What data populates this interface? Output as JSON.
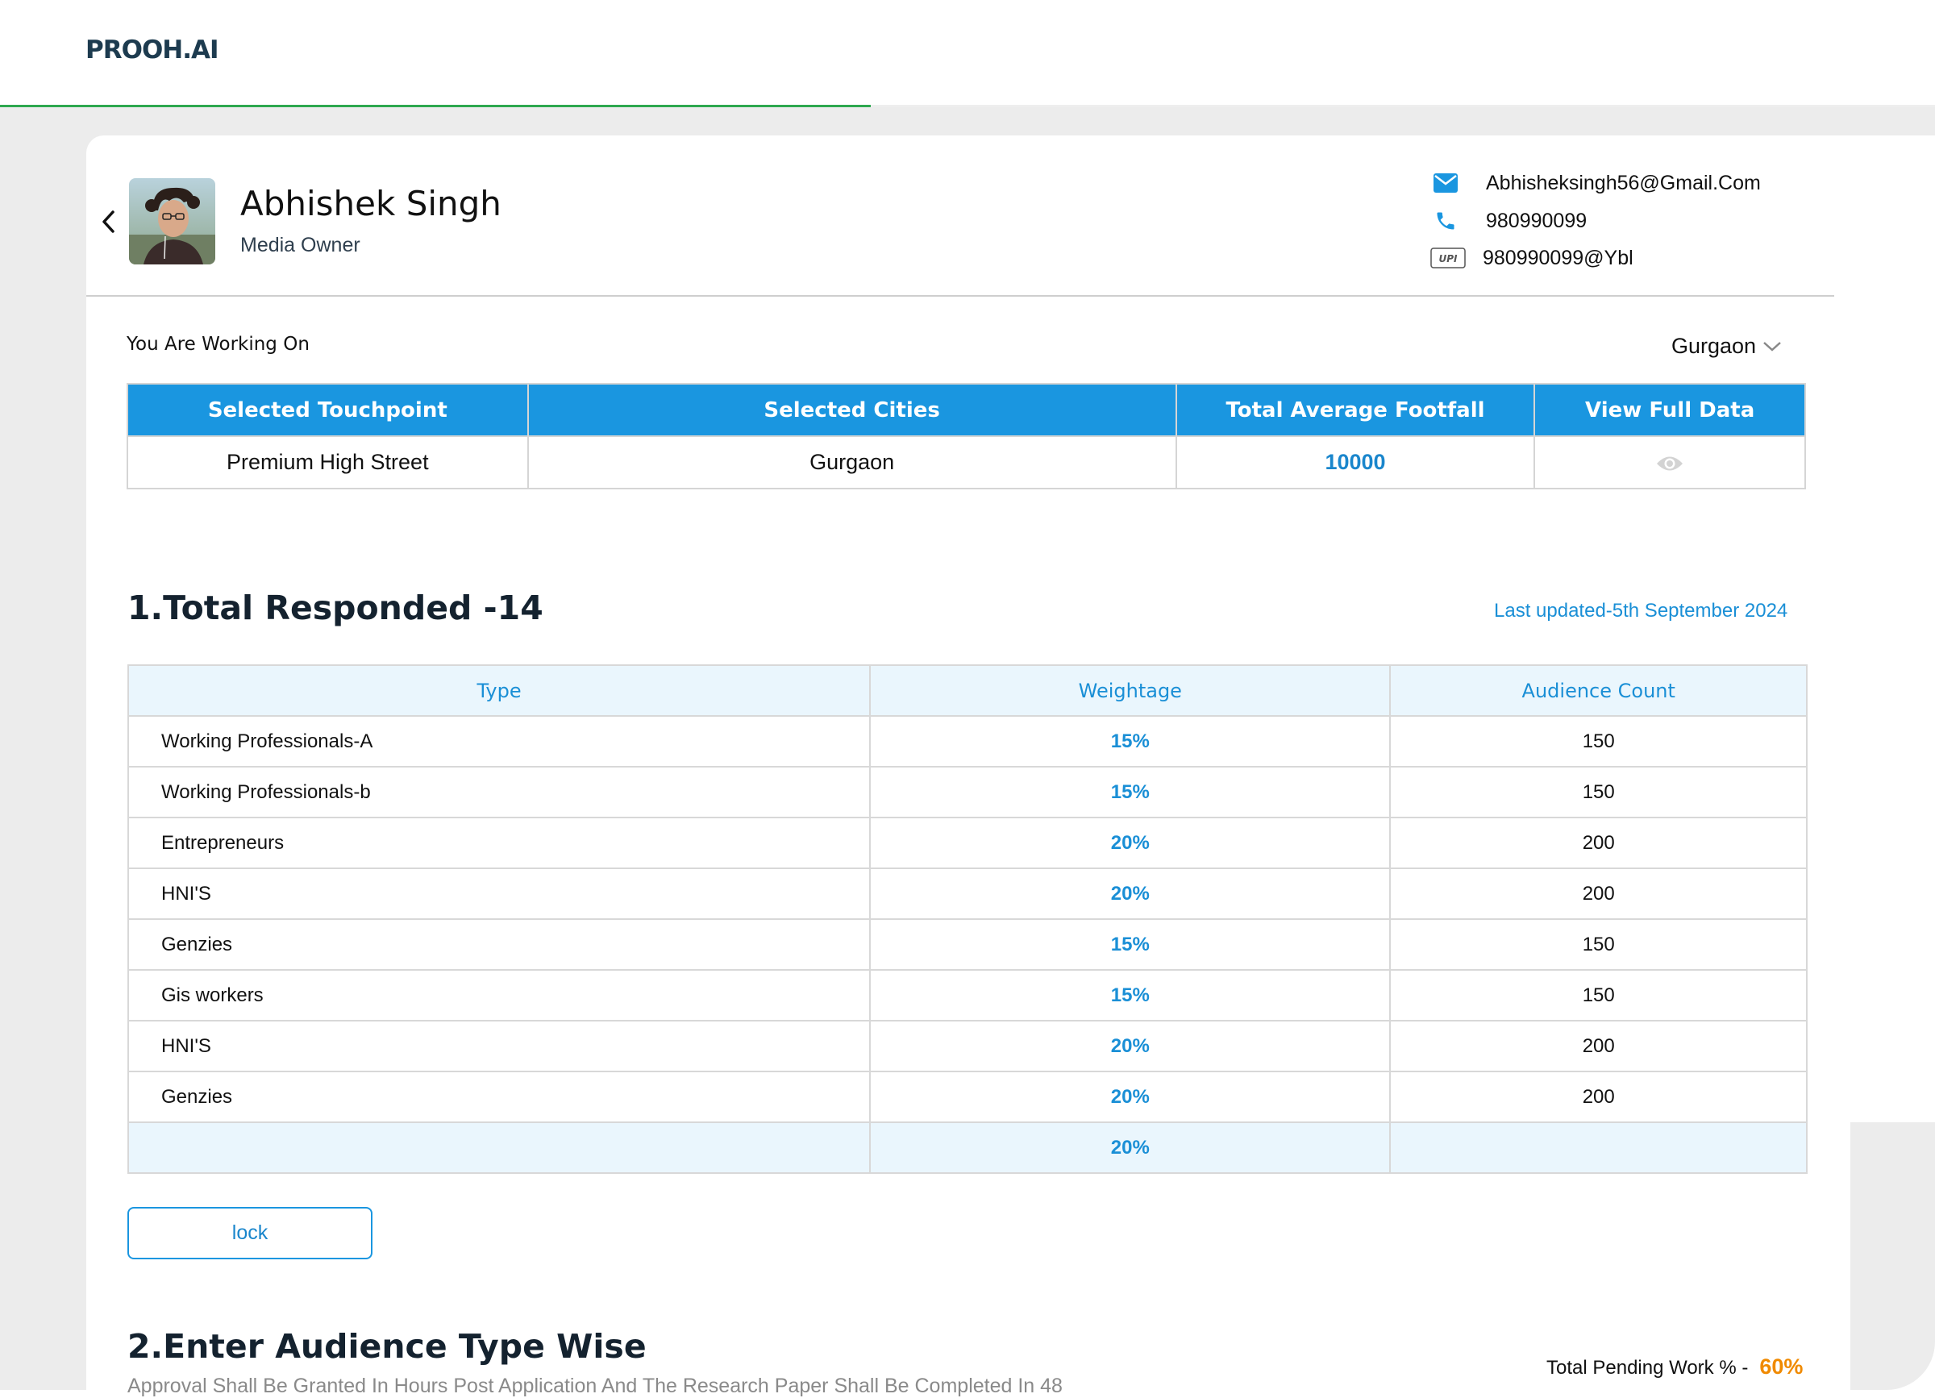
{
  "app": {
    "logo": "PROOH.AI",
    "progress_percent": 45
  },
  "profile": {
    "name": "Abhishek Singh",
    "role": "Media Owner",
    "email": "Abhisheksingh56@Gmail.Com",
    "phone": "980990099",
    "upi": "980990099@Ybl",
    "upi_badge": "UPI"
  },
  "working": {
    "label": "You Are Working On",
    "city": "Gurgaon"
  },
  "summary_table": {
    "headers": [
      "Selected Touchpoint",
      "Selected Cities",
      "Total Average Footfall",
      "View Full Data"
    ],
    "row": {
      "touchpoint": "Premium High Street",
      "cities": "Gurgaon",
      "footfall": "10000"
    }
  },
  "section1": {
    "title": "1.Total Responded -14",
    "updated": "Last updated-5th September 2024",
    "headers": [
      "Type",
      "Weightage",
      "Audience Count"
    ],
    "rows": [
      {
        "type": "Working Professionals-A",
        "weightage": "15%",
        "count": "150"
      },
      {
        "type": "Working Professionals-b",
        "weightage": "15%",
        "count": "150"
      },
      {
        "type": "Entrepreneurs",
        "weightage": "20%",
        "count": "200"
      },
      {
        "type": "HNI'S",
        "weightage": "20%",
        "count": "200"
      },
      {
        "type": "Genzies",
        "weightage": "15%",
        "count": "150"
      },
      {
        "type": "Gis workers",
        "weightage": "15%",
        "count": "150"
      },
      {
        "type": "HNI'S",
        "weightage": "20%",
        "count": "200"
      },
      {
        "type": "Genzies",
        "weightage": "20%",
        "count": "200"
      }
    ],
    "footer_weightage": "20%",
    "lock_label": "lock"
  },
  "section2": {
    "title": "2.Enter Audience Type Wise",
    "approval_text": "Approval Shall Be Granted In  Hours Post Application And The Research Paper Shall Be Completed In 48",
    "pending_label": "Total Pending Work % -",
    "pending_value": "60%"
  },
  "colors": {
    "accent": "#1a96e0",
    "progress": "#2ea84f",
    "pending": "#f08a00",
    "heading": "#14222f"
  }
}
